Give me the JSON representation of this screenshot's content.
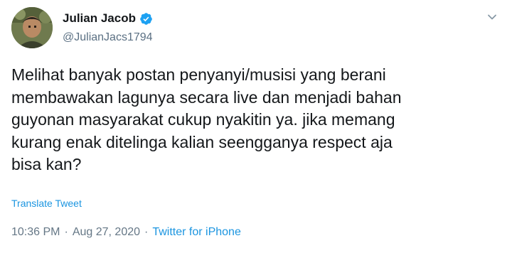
{
  "author": {
    "display_name": "Julian Jacob",
    "handle": "@JulianJacs1794",
    "verified": true,
    "verified_color": "#1da1f2"
  },
  "tweet": {
    "text": "Melihat banyak postan penyanyi/musisi yang berani\nmembawakan lagunya secara live dan menjadi bahan\nguyonan masyarakat cukup nyakitin ya. jika memang\nkurang enak ditelinga kalian seengganya respect aja\nbisa kan?",
    "translate_label": "Translate Tweet",
    "time": "10:36 PM",
    "date": "Aug 27, 2020",
    "separator": "·",
    "source": "Twitter for iPhone"
  },
  "icons": {
    "verified": "verified-badge-icon",
    "menu": "chevron-down-icon"
  },
  "colors": {
    "link": "#1b95e0",
    "muted": "#657786",
    "text": "#14171a"
  }
}
